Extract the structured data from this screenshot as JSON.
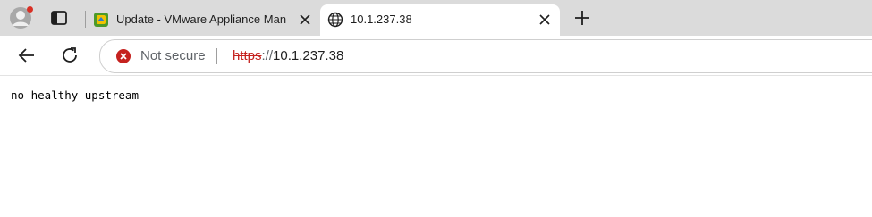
{
  "tabs": [
    {
      "title": "Update - VMware Appliance Man",
      "favicon": "vmware-appliance-icon",
      "active": false
    },
    {
      "title": "10.1.237.38",
      "favicon": "globe-icon",
      "active": true
    }
  ],
  "address_bar": {
    "security_label": "Not secure",
    "url_scheme": "https",
    "url_separator": "://",
    "url_host": "10.1.237.38"
  },
  "page": {
    "body_text": "no healthy upstream"
  },
  "colors": {
    "tabstrip_bg": "#dbdbdb",
    "not_secure_red": "#c5221f"
  }
}
